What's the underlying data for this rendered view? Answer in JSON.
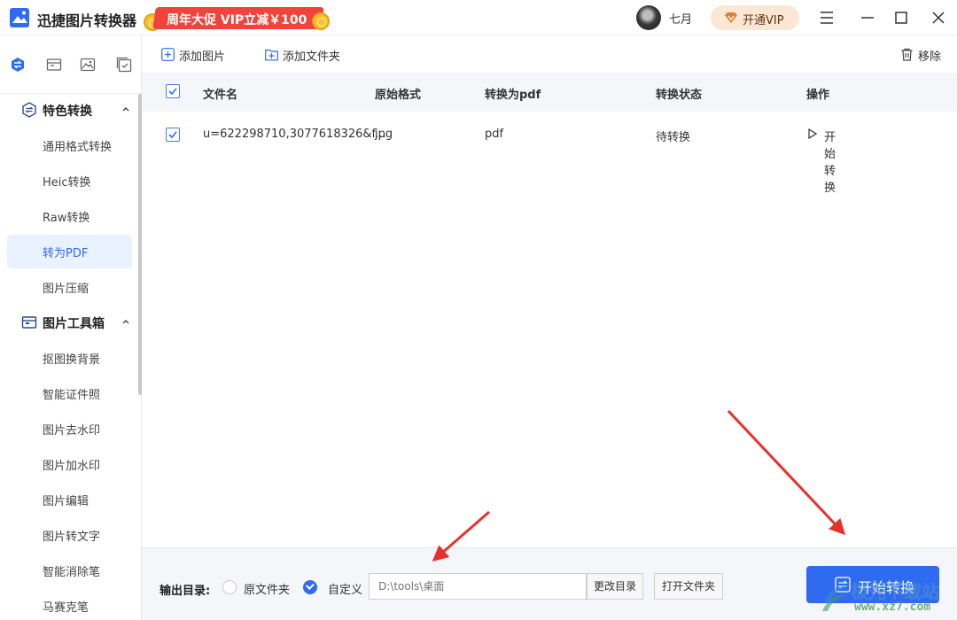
{
  "app": {
    "title": "迅捷图片转换器",
    "promo": "周年大促 VIP立减￥100",
    "username": "七月",
    "vip_button": "开通VIP"
  },
  "sidebar": {
    "sections": [
      {
        "label": "特色转换",
        "items": [
          "通用格式转换",
          "Heic转换",
          "Raw转换",
          "转为PDF",
          "图片压缩"
        ]
      },
      {
        "label": "图片工具箱",
        "items": [
          "抠图换背景",
          "智能证件照",
          "图片去水印",
          "图片加水印",
          "图片编辑",
          "图片转文字",
          "智能消除笔",
          "马赛克笔"
        ]
      }
    ],
    "active_item": "转为PDF"
  },
  "toolbar": {
    "add_image": "添加图片",
    "add_folder": "添加文件夹",
    "remove": "移除"
  },
  "table": {
    "headers": [
      "文件名",
      "原始格式",
      "转换为pdf",
      "转换状态",
      "操作"
    ],
    "rows": [
      {
        "filename": "u=622298710,3077618326&f...",
        "format": "jpg",
        "target": "pdf",
        "status": "待转换",
        "action": "开始转换",
        "checked": true
      }
    ]
  },
  "output": {
    "label": "输出目录:",
    "option_original": "原文件夹",
    "option_custom": "自定义",
    "selected": "自定义",
    "path_placeholder": "D:\\tools\\桌面",
    "change_dir": "更改目录",
    "open_folder": "打开文件夹"
  },
  "convert_button": "开始转换",
  "watermark": {
    "text": "极光下载站",
    "url": "www.xz7.com"
  },
  "colors": {
    "accent": "#2f6bf0",
    "promo": "#f0443a",
    "vip_bg": "#fbe7d3",
    "arrow": "#e8302a"
  }
}
